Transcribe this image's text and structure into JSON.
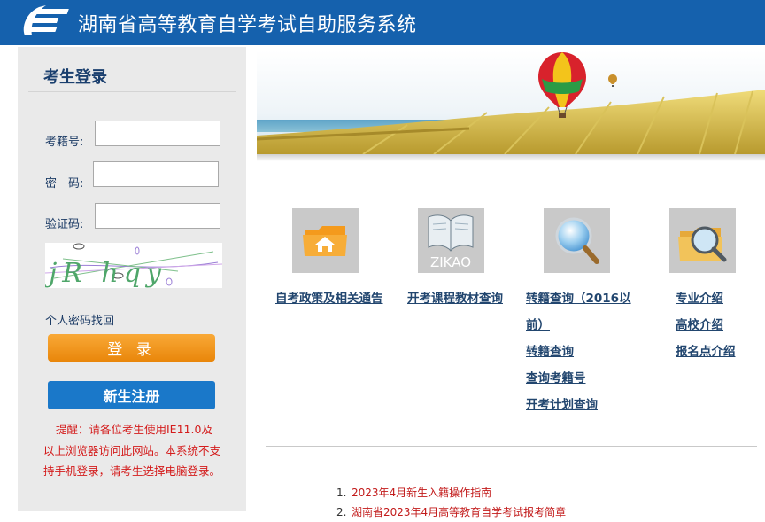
{
  "header": {
    "title": "湖南省高等教育自学考试自助服务系统"
  },
  "login": {
    "title": "考生登录",
    "exam_id_label": "考籍号:",
    "password_label": "密　码:",
    "captcha_label": "验证码:",
    "captcha_text": "jR hqy",
    "forgot_password": "个人密码找回",
    "login_button": "登 录",
    "register_button": "新生注册",
    "notice": "提醒：请各位考生使用IE11.0及以上浏览器访问此网站。本系统不支持手机登录，请考生选择电脑登录。"
  },
  "tiles": [
    {
      "icon": "folder-home-icon",
      "links": [
        "自考政策及相关通告"
      ]
    },
    {
      "icon": "zikao-book-icon",
      "icon_text": "ZIKAO",
      "links": [
        "开考课程教材查询"
      ]
    },
    {
      "icon": "magnifier-icon",
      "links": [
        "转籍查询（2016以",
        "前）",
        "转籍查询",
        "查询考籍号",
        "开考计划查询"
      ]
    },
    {
      "icon": "folder-magnifier-icon",
      "links": [
        "专业介绍",
        "高校介绍",
        "报名点介绍"
      ]
    }
  ],
  "news": [
    {
      "num": "1.",
      "title": "2023年4月新生入籍操作指南"
    },
    {
      "num": "2.",
      "title": "湖南省2023年4月高等教育自学考试报考简章"
    }
  ],
  "colors": {
    "header": "#1561ad",
    "login_button": "#f39a1f",
    "register_button": "#1a78c9",
    "notice": "#d41c1c",
    "link": "#22466f"
  }
}
